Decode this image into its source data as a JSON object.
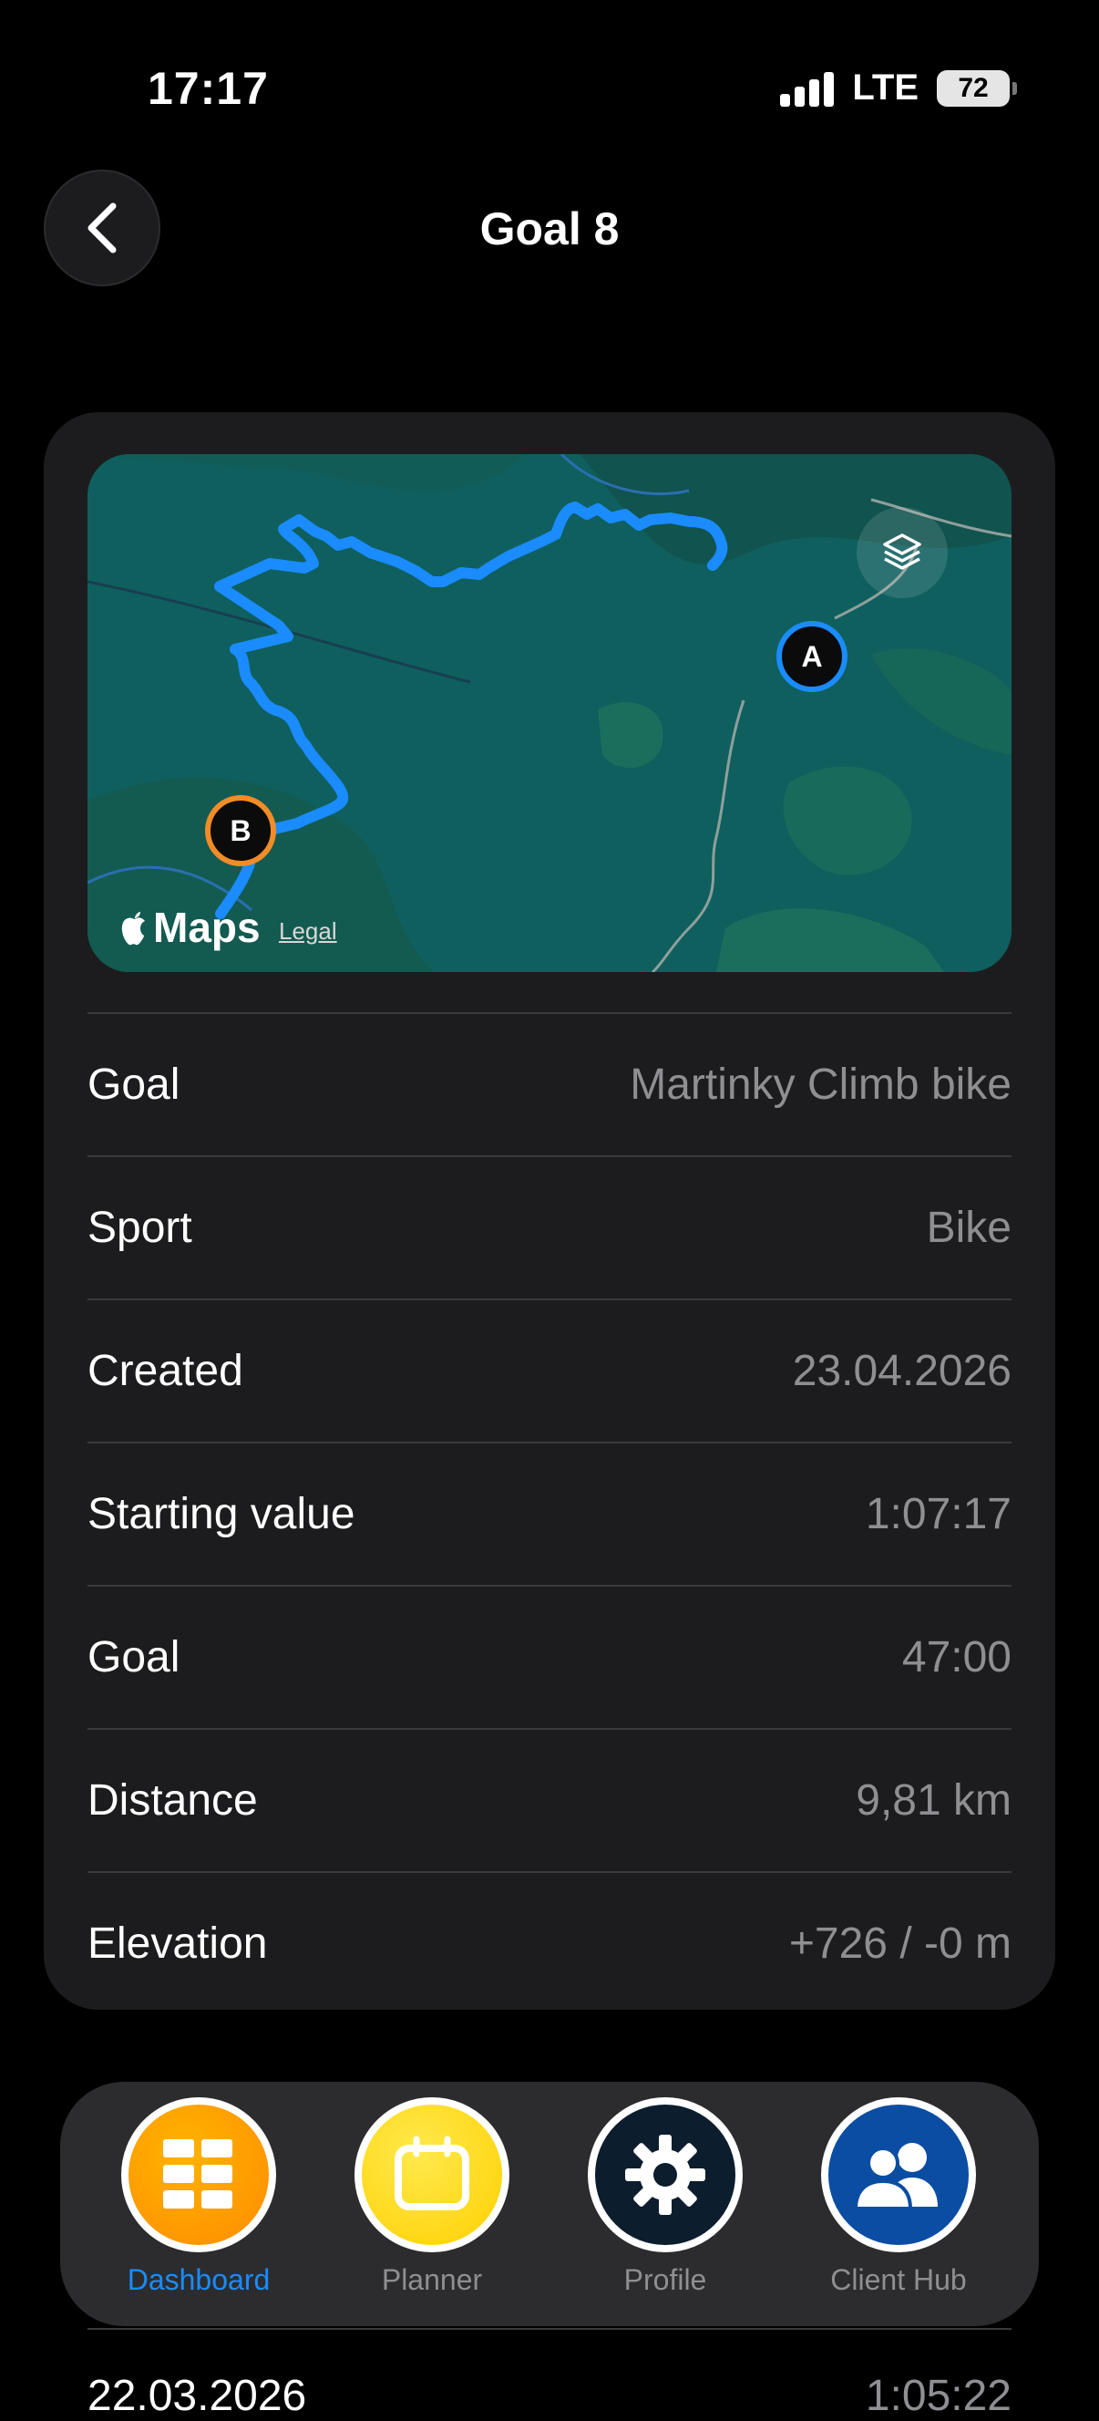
{
  "status": {
    "time": "17:17",
    "network": "LTE",
    "battery": "72"
  },
  "header": {
    "title": "Goal 8"
  },
  "map": {
    "attribution": "Maps",
    "legal": "Legal",
    "marker_start": "A",
    "marker_end": "B"
  },
  "details": [
    {
      "label": "Goal",
      "value": "Martinky Climb bike"
    },
    {
      "label": "Sport",
      "value": "Bike"
    },
    {
      "label": "Created",
      "value": "23.04.2026"
    },
    {
      "label": "Starting value",
      "value": "1:07:17"
    },
    {
      "label": "Goal",
      "value": "47:00"
    },
    {
      "label": "Distance",
      "value": "9,81 km"
    },
    {
      "label": "Elevation",
      "value": "+726 / -0 m"
    }
  ],
  "tabs": [
    {
      "label": "Dashboard",
      "icon": "grid-icon",
      "active": true,
      "color": "#ff9500"
    },
    {
      "label": "Planner",
      "icon": "calendar-icon",
      "active": false,
      "color": "#ffd60a"
    },
    {
      "label": "Profile",
      "icon": "gear-icon",
      "active": false,
      "color": "#0c1d2e"
    },
    {
      "label": "Client Hub",
      "icon": "people-icon",
      "active": false,
      "color": "#0a4da3"
    }
  ],
  "peek": {
    "left": "22.03.2026",
    "right": "1:05:22"
  },
  "colors": {
    "accent": "#1a8cff",
    "route": "#1a8cff",
    "start": "#1a8cff",
    "end": "#f28c28"
  }
}
